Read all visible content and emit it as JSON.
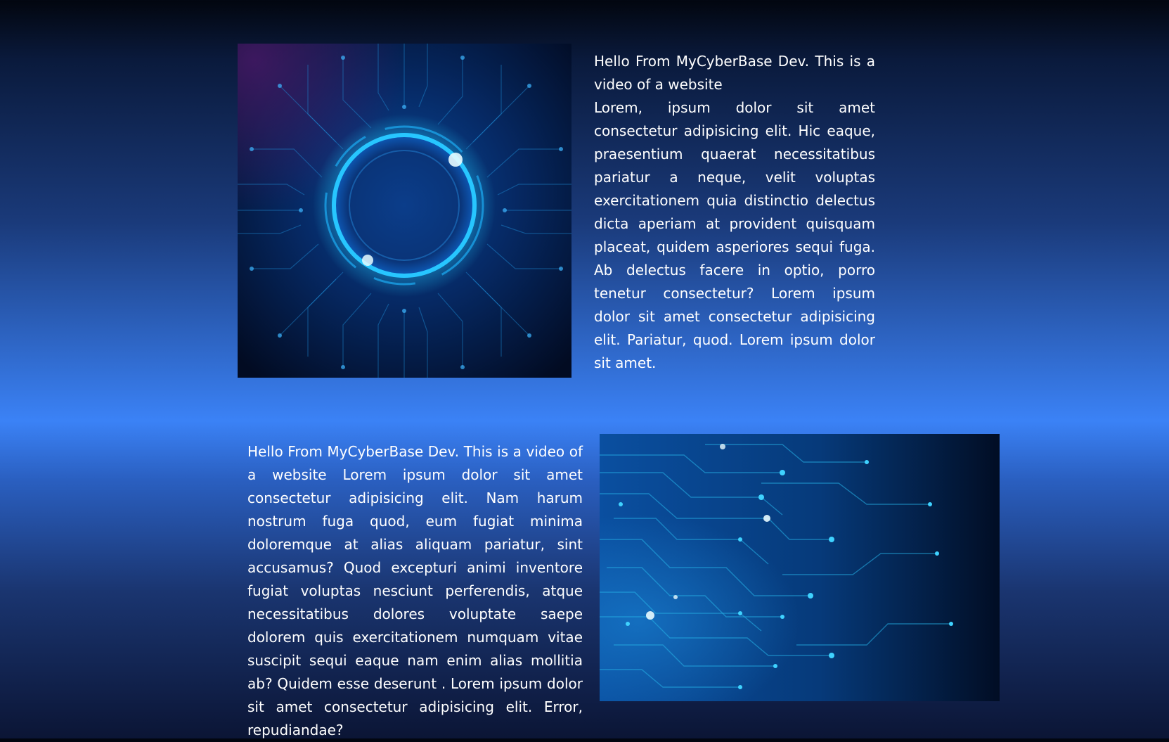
{
  "section1": {
    "image_alt": "circuit circle",
    "paragraph": "Hello From MyCyberBase Dev. This is a video of a website\nLorem, ipsum dolor sit amet consectetur adipisicing elit. Hic eaque, praesentium quaerat necessitatibus pariatur a neque, velit voluptas exercitationem quia distinctio delectus dicta aperiam at provident quisquam placeat, quidem asperiores sequi fuga. Ab delectus facere in optio, porro tenetur consectetur? Lorem ipsum dolor sit amet consectetur adipisicing elit. Pariatur, quod. Lorem ipsum dolor sit amet."
  },
  "section2": {
    "image_alt": "circuit lines",
    "paragraph": "Hello From MyCyberBase Dev. This is a video of a website Lorem ipsum dolor sit amet consectetur adipisicing elit. Nam harum nostrum fuga quod, eum fugiat minima doloremque at alias aliquam pariatur, sint accusamus? Quod excepturi animi inventore fugiat voluptas nesciunt perferendis, atque necessitatibus dolores voluptate saepe dolorem quis exercitationem numquam vitae suscipit sequi eaque nam enim alias mollitia ab? Quidem esse deserunt . Lorem ipsum dolor sit amet consectetur adipisicing elit. Error, repudiandae?"
  },
  "colors": {
    "glow": "#22d3ff",
    "deep": "#02163a"
  }
}
